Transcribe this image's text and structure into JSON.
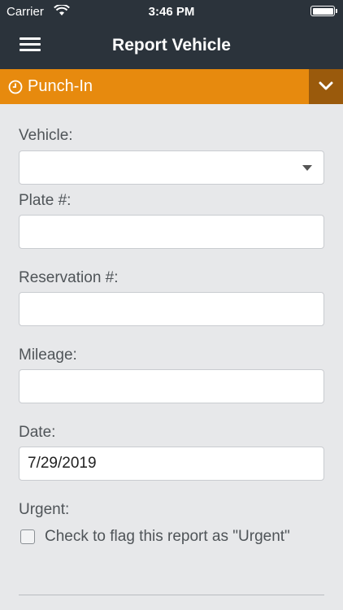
{
  "status_bar": {
    "carrier": "Carrier",
    "time": "3:46 PM"
  },
  "header": {
    "title": "Report Vehicle"
  },
  "punch_bar": {
    "label": "Punch-In"
  },
  "form": {
    "vehicle": {
      "label": "Vehicle:",
      "value": ""
    },
    "plate": {
      "label": "Plate #:",
      "value": ""
    },
    "reservation": {
      "label": "Reservation #:",
      "value": ""
    },
    "mileage": {
      "label": "Mileage:",
      "value": ""
    },
    "date": {
      "label": "Date:",
      "value": "7/29/2019"
    },
    "urgent": {
      "label": "Urgent:",
      "checkbox_label": "Check to flag this report as \"Urgent\"",
      "checked": false
    }
  },
  "colors": {
    "header_bg": "#2b333b",
    "accent": "#e78a0e",
    "accent_dark": "#9a5a0c",
    "page_bg": "#e7e8ea"
  }
}
